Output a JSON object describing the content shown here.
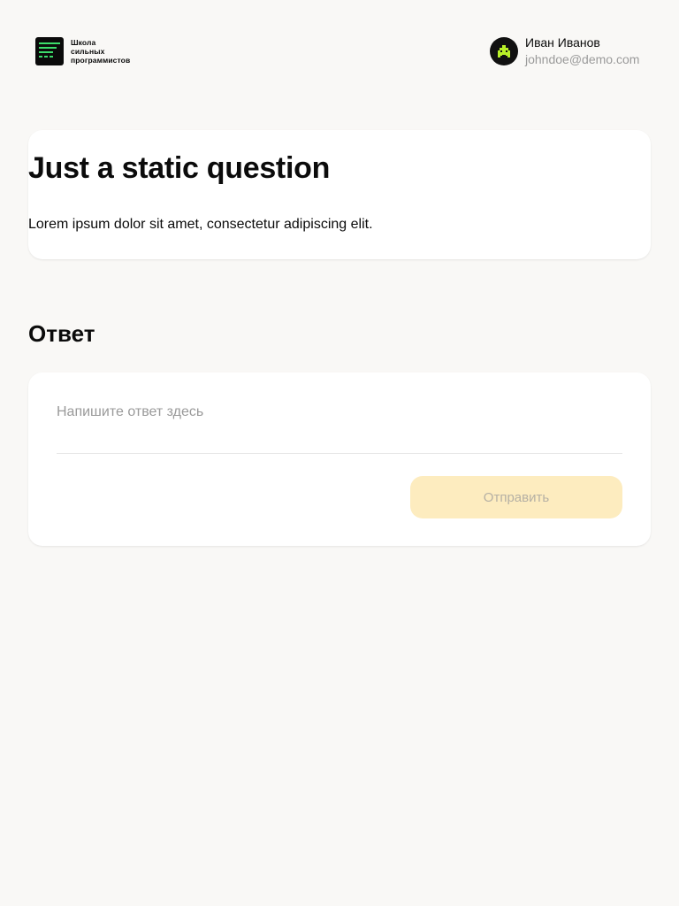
{
  "header": {
    "logo": {
      "icon": "school-logo-icon",
      "lines": [
        "Школа",
        "сильных",
        "программистов"
      ]
    },
    "user": {
      "avatar_icon": "alien-avatar-icon",
      "name": "Иван Иванов",
      "email": "johndoe@demo.com"
    }
  },
  "question": {
    "title": "Just a static question",
    "text": "Lorem ipsum dolor sit amet, consectetur adipiscing elit."
  },
  "answer": {
    "heading": "Ответ",
    "placeholder": "Напишите ответ здесь",
    "value": "",
    "submit_label": "Отправить",
    "submit_disabled": true
  },
  "colors": {
    "background": "#f9f8f6",
    "card": "#ffffff",
    "logo_accent": "#3ddc6b",
    "avatar_accent": "#b8f028",
    "submit_disabled_bg": "#fdecbf",
    "muted_text": "#9a9a9a"
  }
}
